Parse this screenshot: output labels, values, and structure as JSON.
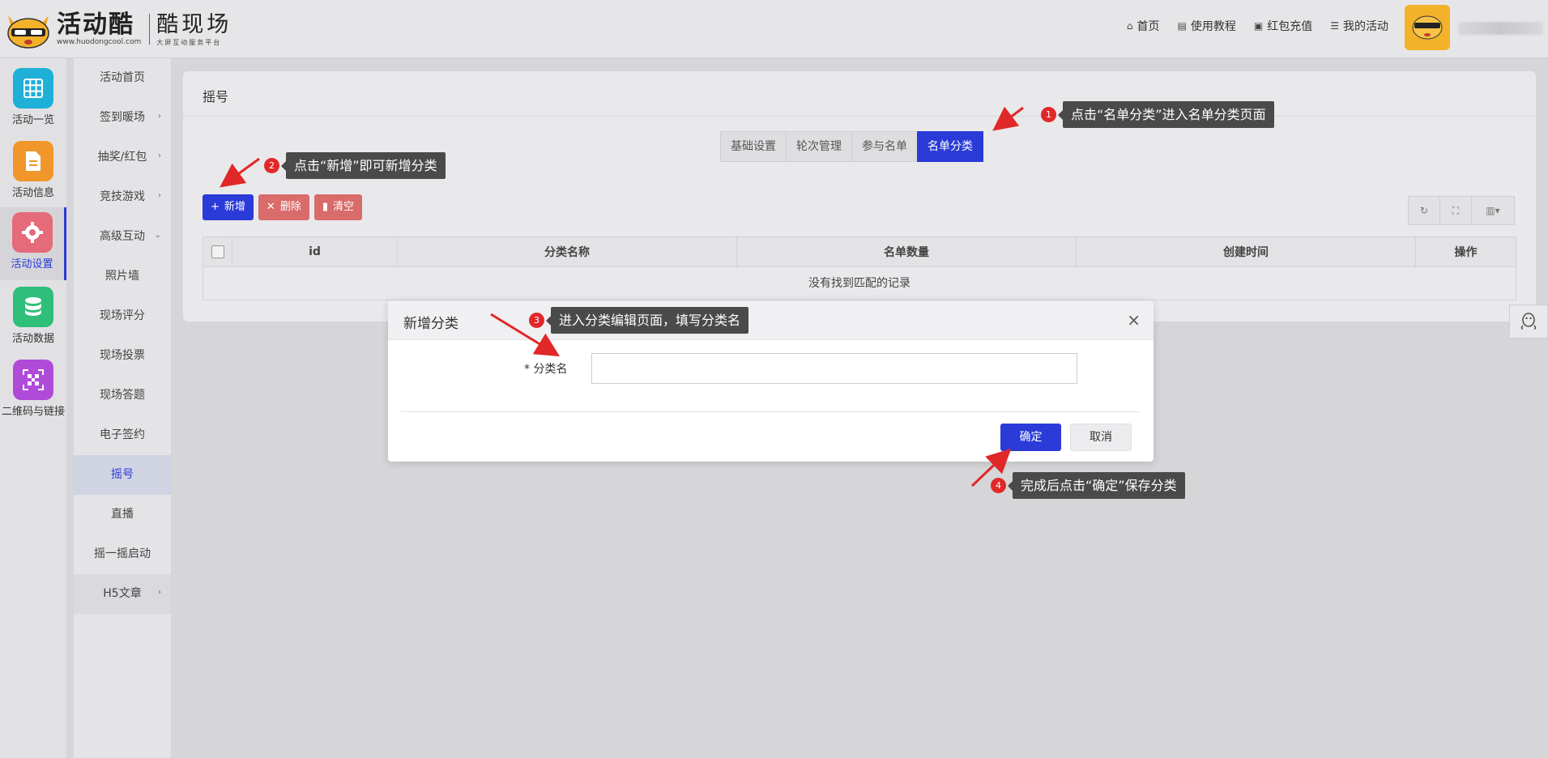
{
  "header": {
    "brand_cn": "活动酷",
    "brand_url": "www.huodongcool.com",
    "brand2_cn": "酷现场",
    "brand2_sub": "大屏互动服务平台",
    "nav": [
      {
        "icon": "home-icon",
        "label": "首页"
      },
      {
        "icon": "book-icon",
        "label": "使用教程"
      },
      {
        "icon": "wallet-icon",
        "label": "红包充值"
      },
      {
        "icon": "list-icon",
        "label": "我的活动"
      }
    ],
    "avatar_text": "活动酷"
  },
  "sidebar1": {
    "items": [
      {
        "label": "活动一览",
        "icon": "grid-icon",
        "color": "#1fb0d8"
      },
      {
        "label": "活动信息",
        "icon": "document-icon",
        "color": "#f0962a"
      },
      {
        "label": "活动设置",
        "icon": "gear-icon",
        "color": "#e56a7a",
        "active": true
      },
      {
        "label": "活动数据",
        "icon": "database-icon",
        "color": "#2fbf7a"
      },
      {
        "label": "二维码与链接",
        "icon": "qrcode-icon",
        "color": "#b04ad8"
      }
    ]
  },
  "sidebar2": {
    "items": [
      {
        "label": "活动首页",
        "arrow": ""
      },
      {
        "label": "签到暖场",
        "arrow": "›"
      },
      {
        "label": "抽奖/红包",
        "arrow": "›"
      },
      {
        "label": "竞技游戏",
        "arrow": "›"
      },
      {
        "label": "高级互动",
        "arrow": "⌄"
      },
      {
        "label": "照片墙",
        "arrow": ""
      },
      {
        "label": "现场评分",
        "arrow": ""
      },
      {
        "label": "现场投票",
        "arrow": ""
      },
      {
        "label": "现场答题",
        "arrow": ""
      },
      {
        "label": "电子签约",
        "arrow": ""
      },
      {
        "label": "摇号",
        "arrow": "",
        "active": true
      },
      {
        "label": "直播",
        "arrow": ""
      },
      {
        "label": "摇一摇启动",
        "arrow": ""
      },
      {
        "label": "H5文章",
        "arrow": "›"
      }
    ]
  },
  "panel": {
    "title": "摇号",
    "tabs": [
      "基础设置",
      "轮次管理",
      "参与名单",
      "名单分类"
    ],
    "active_tab": 3,
    "toolbar": {
      "add": "新增",
      "delete": "删除",
      "clear": "清空"
    },
    "table": {
      "columns": [
        "id",
        "分类名称",
        "名单数量",
        "创建时间",
        "操作"
      ],
      "empty_text": "没有找到匹配的记录"
    }
  },
  "modal": {
    "title": "新增分类",
    "field_label": "分类名",
    "field_required": "*",
    "field_value": "",
    "ok": "确定",
    "cancel": "取消"
  },
  "annotations": [
    {
      "num": "1",
      "text": "点击“名单分类”进入名单分类页面"
    },
    {
      "num": "2",
      "text": "点击“新增”即可新增分类"
    },
    {
      "num": "3",
      "text": "进入分类编辑页面，填写分类名"
    },
    {
      "num": "4",
      "text": "完成后点击“确定”保存分类"
    }
  ],
  "colors": {
    "accent": "#2a3bd8",
    "danger": "#d96b6b",
    "annotation_badge": "#e12828"
  }
}
